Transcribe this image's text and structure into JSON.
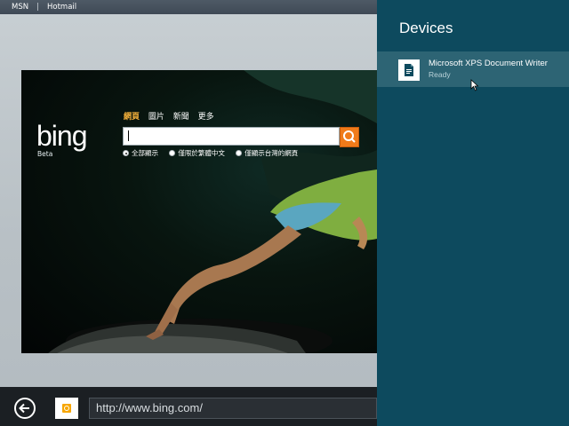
{
  "topbar": {
    "msn": "MSN",
    "separator": "|",
    "hotmail": "Hotmail"
  },
  "bing": {
    "logo_text": "bing",
    "beta_label": "Beta",
    "tabs": [
      "網頁",
      "圖片",
      "新聞",
      "更多"
    ],
    "search": {
      "value": ""
    },
    "radio_options": [
      {
        "label": "全部顯示",
        "checked": true
      },
      {
        "label": "僅限於繁體中文",
        "checked": false
      },
      {
        "label": "僅顯示台灣的網頁",
        "checked": false
      }
    ]
  },
  "address_bar": {
    "url": "http://www.bing.com/"
  },
  "devices": {
    "title": "Devices",
    "items": [
      {
        "name": "Microsoft XPS Document Writer",
        "status": "Ready"
      }
    ]
  },
  "colors": {
    "charm_bg": "#0d4a5e",
    "charm_item_hover": "#2d6474",
    "search_button": "#f07b1a",
    "active_tab": "#f7b23b"
  },
  "icons": {
    "back": "back-arrow-icon",
    "favicon": "bing-favicon-icon",
    "search": "search-icon",
    "printer": "document-icon",
    "cursor": "mouse-cursor-icon"
  }
}
